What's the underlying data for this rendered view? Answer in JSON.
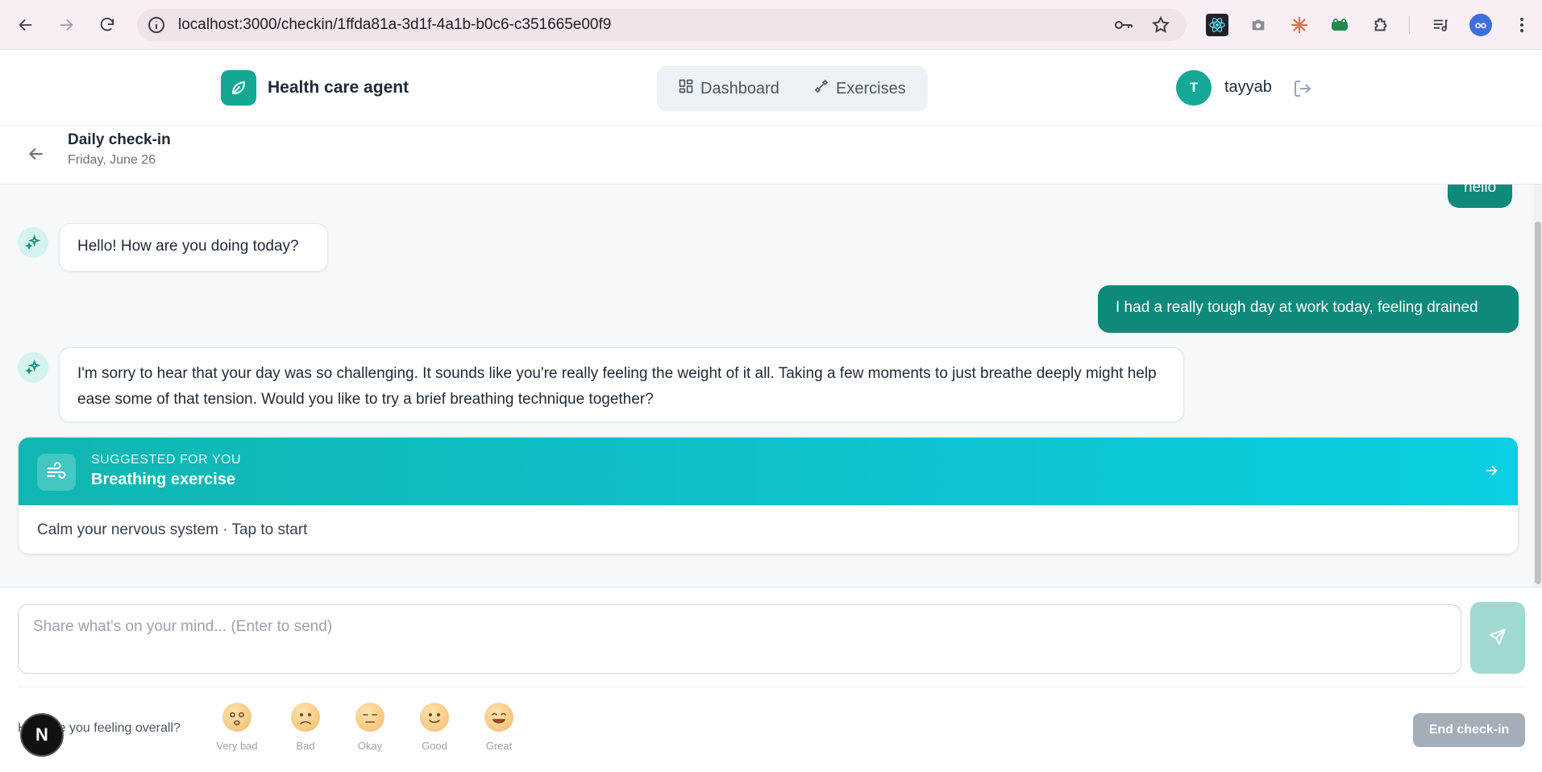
{
  "browser": {
    "url": "localhost:3000/checkin/1ffda81a-3d1f-4a1b-b0c6-c351665e00f9"
  },
  "header": {
    "brand": "Health care agent",
    "nav": [
      {
        "label": "Dashboard",
        "icon": "grid-icon"
      },
      {
        "label": "Exercises",
        "icon": "exercise-icon"
      }
    ],
    "avatar_initial": "T",
    "username": "tayyab"
  },
  "subheader": {
    "title": "Daily check-in",
    "date": "Friday, June 26"
  },
  "messages": [
    {
      "role": "user",
      "text": "hello"
    },
    {
      "role": "assistant",
      "text": "Hello! How are you doing today?"
    },
    {
      "role": "user",
      "text": "I had a really tough day at work today, feeling drained"
    },
    {
      "role": "assistant",
      "text": "I'm sorry to hear that your day was so challenging. It sounds like you're really feeling the weight of it all. Taking a few moments to just breathe deeply might help ease some of that tension. Would you like to try a brief breathing technique together?"
    }
  ],
  "suggestion": {
    "label": "SUGGESTED FOR YOU",
    "title": "Breathing exercise",
    "description": "Calm your nervous system · Tap to start"
  },
  "composer": {
    "placeholder": "Share what's on your mind... (Enter to send)"
  },
  "mood": {
    "question": "How are you feeling overall?",
    "options": [
      "Very bad",
      "Bad",
      "Okay",
      "Good",
      "Great"
    ]
  },
  "end_button": "End check-in",
  "dev_badge": "N",
  "colors": {
    "accent": "#0f8a7a",
    "suggestion_gradient_start": "#10b6b0",
    "suggestion_gradient_end": "#09cfe0"
  }
}
